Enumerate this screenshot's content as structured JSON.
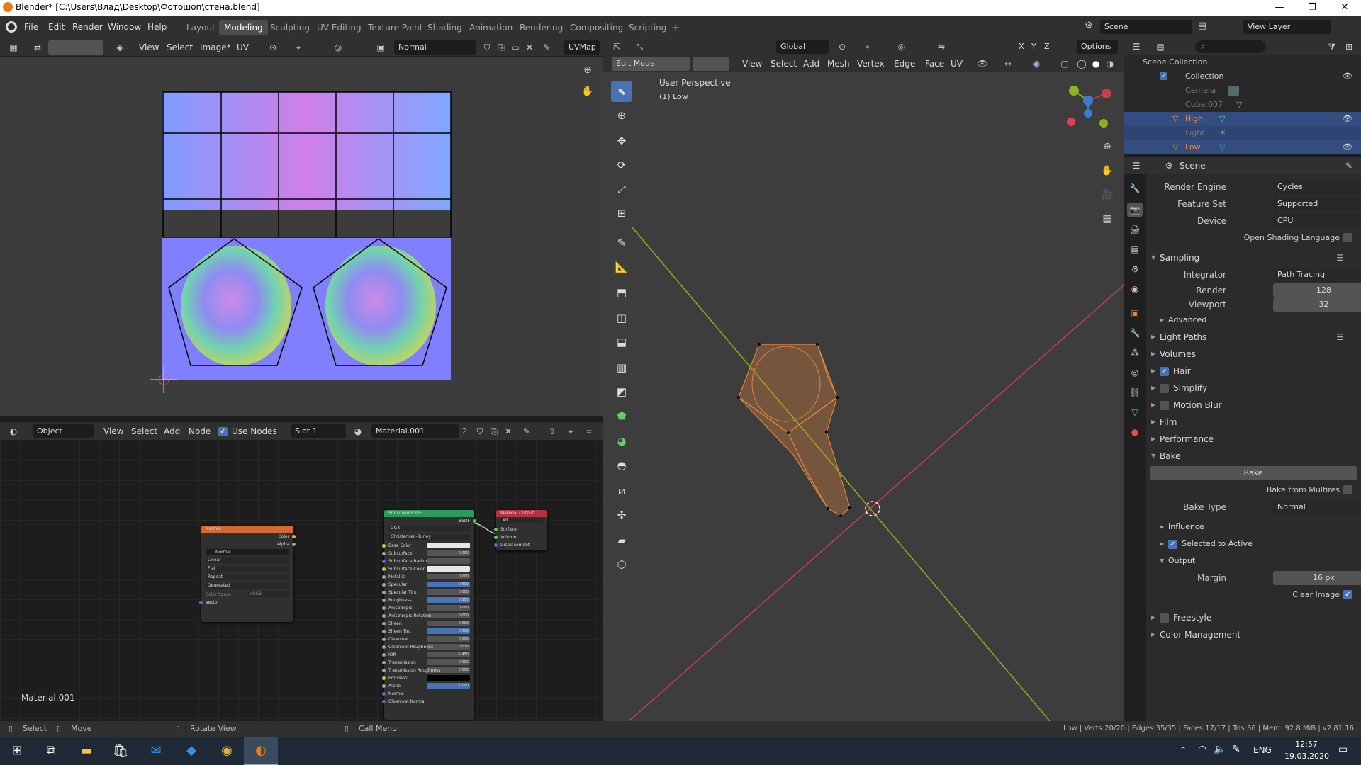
{
  "window": {
    "title": "Blender* [C:\\Users\\Влад\\Desktop\\Фотошоп\\стена.blend]",
    "controls": [
      "—",
      "❐",
      "✕"
    ]
  },
  "topbar": {
    "menus": [
      "File",
      "Edit",
      "Render",
      "Window",
      "Help"
    ],
    "workspaces": [
      "Layout",
      "Modeling",
      "Sculpting",
      "UV Editing",
      "Texture Paint",
      "Shading",
      "Animation",
      "Rendering",
      "Compositing",
      "Scripting",
      "+"
    ],
    "active_workspace": "Modeling",
    "scene": "Scene",
    "view_layer": "View Layer"
  },
  "uv_editor": {
    "menus": [
      "View",
      "Select",
      "Image*",
      "UV"
    ],
    "image_name": "Normal",
    "uvmap": "UVMap"
  },
  "node_editor": {
    "mode": "Object",
    "menus": [
      "View",
      "Select",
      "Add",
      "Node"
    ],
    "use_nodes_label": "Use Nodes",
    "slot": "Slot 1",
    "material": "Material.001",
    "users": "2",
    "material_label": "Material.001",
    "nodes": {
      "normal": {
        "title": "Normal",
        "outputs": [
          "Color",
          "Alpha"
        ],
        "image": "Normal",
        "settings": [
          "Linear",
          "Flat",
          "Repeat",
          "Generated"
        ],
        "color_space_label": "Color Space",
        "color_space_value": "sRGB",
        "input": "Vector"
      },
      "bsdf": {
        "title": "Principled BSDF",
        "output": "BSDF",
        "dist": "GGX",
        "sss": "Christensen-Burley",
        "inputs": [
          {
            "label": "Base Color",
            "value": ""
          },
          {
            "label": "Subsurface",
            "value": "0.000"
          },
          {
            "label": "Subsurface Radius",
            "value": ""
          },
          {
            "label": "Subsurface Color",
            "value": ""
          },
          {
            "label": "Metallic",
            "value": "0.000"
          },
          {
            "label": "Specular",
            "value": "0.500"
          },
          {
            "label": "Specular Tint",
            "value": "0.000"
          },
          {
            "label": "Roughness",
            "value": "0.500"
          },
          {
            "label": "Anisotropic",
            "value": "0.000"
          },
          {
            "label": "Anisotropic Rotation",
            "value": "0.000"
          },
          {
            "label": "Sheen",
            "value": "0.000"
          },
          {
            "label": "Sheen Tint",
            "value": "0.500"
          },
          {
            "label": "Clearcoat",
            "value": "0.000"
          },
          {
            "label": "Clearcoat Roughness",
            "value": "0.030"
          },
          {
            "label": "IOR",
            "value": "1.450"
          },
          {
            "label": "Transmission",
            "value": "0.000"
          },
          {
            "label": "Transmission Roughness",
            "value": "0.000"
          },
          {
            "label": "Emission",
            "value": ""
          },
          {
            "label": "Alpha",
            "value": "1.000"
          },
          {
            "label": "Normal",
            "value": ""
          },
          {
            "label": "Clearcoat Normal",
            "value": ""
          }
        ]
      },
      "output": {
        "title": "Material Output",
        "target": "All",
        "inputs": [
          "Surface",
          "Volume",
          "Displacement"
        ]
      }
    }
  },
  "viewport": {
    "mode": "Edit Mode",
    "menus": [
      "View",
      "Select",
      "Add",
      "Mesh",
      "Vertex",
      "Edge",
      "Face",
      "UV"
    ],
    "orientation": "Global",
    "options_label": "Options",
    "overlay_text": "User Perspective",
    "overlay_sub": "(1) Low",
    "axes": [
      "X",
      "Y",
      "Z"
    ]
  },
  "outliner": {
    "root": "Scene Collection",
    "items": [
      {
        "name": "Collection",
        "selected": false
      },
      {
        "name": "Camera",
        "selected": false
      },
      {
        "name": "Cube.007",
        "selected": false
      },
      {
        "name": "High",
        "selected": true
      },
      {
        "name": "Light",
        "selected": false
      },
      {
        "name": "Low",
        "selected": true
      }
    ]
  },
  "properties": {
    "context": "Scene",
    "render_engine_label": "Render Engine",
    "render_engine": "Cycles",
    "feature_set_label": "Feature Set",
    "feature_set": "Supported",
    "device_label": "Device",
    "device": "CPU",
    "osl_label": "Open Shading Language",
    "sampling": "Sampling",
    "integrator_label": "Integrator",
    "integrator": "Path Tracing",
    "render_label": "Render",
    "render_samples": "128",
    "viewport_label": "Viewport",
    "viewport_samples": "32",
    "advanced": "Advanced",
    "light_paths": "Light Paths",
    "volumes": "Volumes",
    "hair": "Hair",
    "simplify": "Simplify",
    "motion_blur": "Motion Blur",
    "film": "Film",
    "performance": "Performance",
    "bake_section": "Bake",
    "bake_button": "Bake",
    "bake_multires": "Bake from Multires",
    "bake_type_label": "Bake Type",
    "bake_type": "Normal",
    "influence": "Influence",
    "selected_to_active": "Selected to Active",
    "output": "Output",
    "margin_label": "Margin",
    "margin": "16 px",
    "clear_image": "Clear Image",
    "freestyle": "Freestyle",
    "color_management": "Color Management"
  },
  "statusbar": {
    "select": "Select",
    "move": "Move",
    "rotate": "Rotate View",
    "call_menu": "Call Menu",
    "stats": "Low | Verts:20/20 | Edges:35/35 | Faces:17/17 | Tris:36 | Mem: 92.8 MiB | v2.81.16"
  },
  "taskbar": {
    "lang": "ENG",
    "time": "12:57",
    "date": "19.03.2020"
  },
  "colors": {
    "accent": "#4772b3",
    "edit_orange": "#e0883f",
    "x_axis": "#c83e4e",
    "y_axis": "#8ab322",
    "z_axis": "#3d7cd1"
  }
}
